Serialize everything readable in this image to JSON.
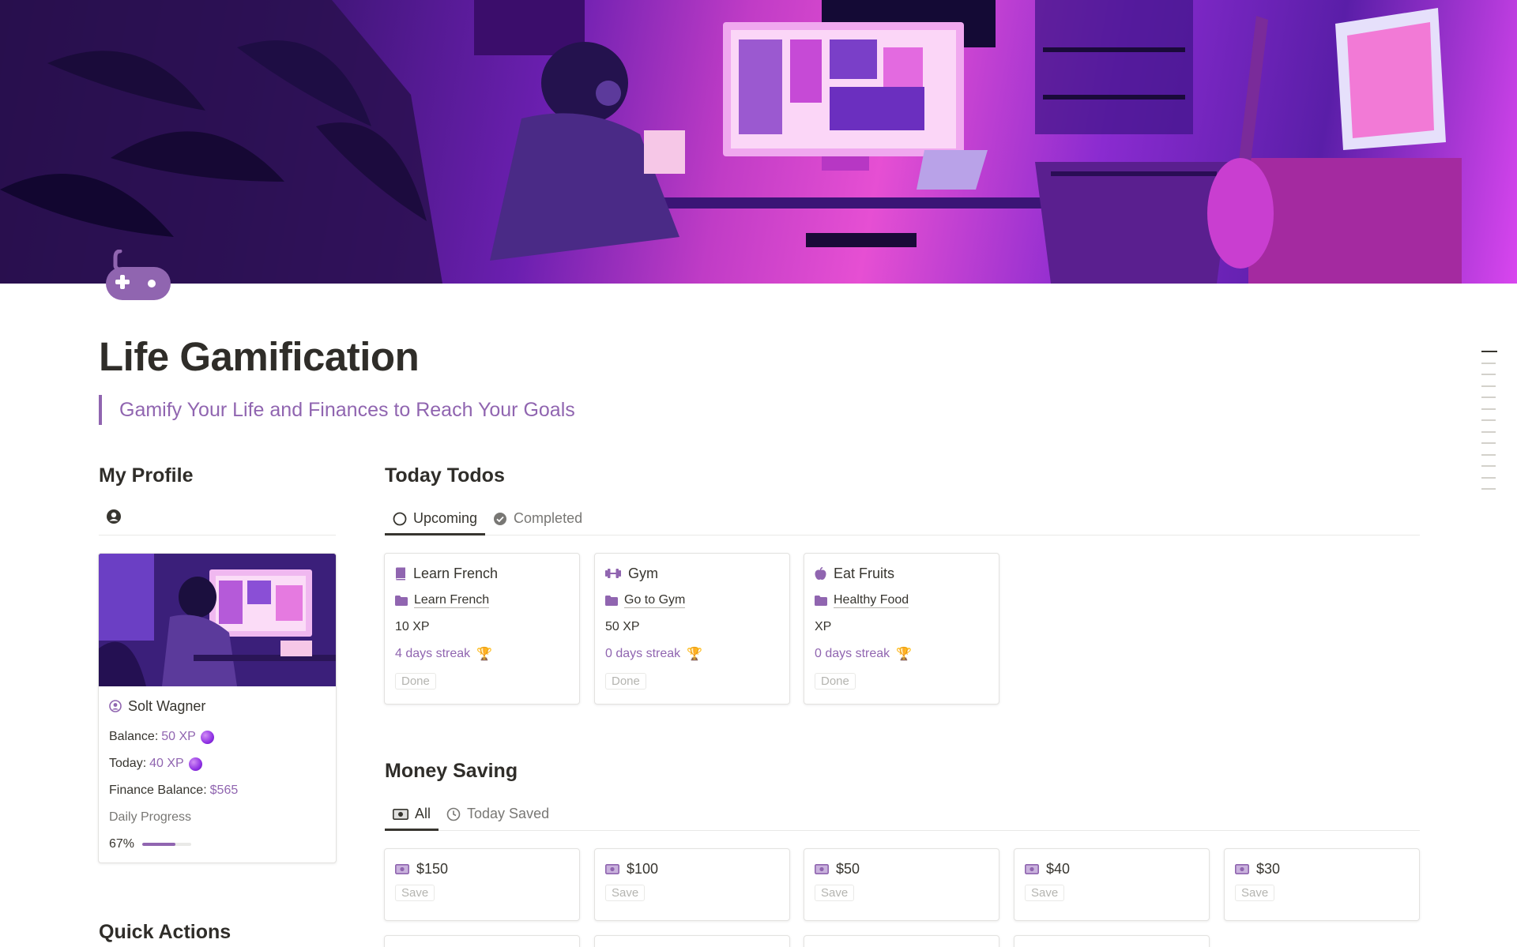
{
  "page": {
    "title": "Life Gamification",
    "quote": "Gamify Your Life and Finances to Reach Your Goals",
    "icon": "gamepad-icon"
  },
  "profile": {
    "heading": "My Profile",
    "icon": "user-circle-icon",
    "name": "Solt Wagner",
    "balance_label": "Balance:",
    "balance_value": "50 XP",
    "today_label": "Today:",
    "today_value": "40 XP",
    "finance_label": "Finance Balance:",
    "finance_value": "$565",
    "daily_progress_label": "Daily Progress",
    "progress_text": "67%",
    "progress": 0.67
  },
  "todos": {
    "heading": "Today Todos",
    "tabs": [
      {
        "label": "Upcoming",
        "icon": "circle-icon",
        "active": true
      },
      {
        "label": "Completed",
        "icon": "check-circle-icon",
        "active": false
      }
    ],
    "cards": [
      {
        "title": "Learn French",
        "icon": "book-icon",
        "category": "Learn French",
        "xp": "10 XP",
        "streak": "4 days streak",
        "button": "Done"
      },
      {
        "title": "Gym",
        "icon": "dumbbell-icon",
        "category": "Go to Gym",
        "xp": "50 XP",
        "streak": "0 days streak",
        "button": "Done"
      },
      {
        "title": "Eat Fruits",
        "icon": "apple-icon",
        "category": "Healthy Food",
        "xp": "XP",
        "streak": "0 days streak",
        "button": "Done"
      }
    ]
  },
  "money": {
    "heading": "Money Saving",
    "tabs": [
      {
        "label": "All",
        "icon": "money-icon",
        "active": true
      },
      {
        "label": "Today Saved",
        "icon": "clock-icon",
        "active": false
      }
    ],
    "cards": [
      {
        "title": "$150",
        "button": "Save"
      },
      {
        "title": "$100",
        "button": "Save"
      },
      {
        "title": "$50",
        "button": "Save"
      },
      {
        "title": "$40",
        "button": "Save"
      },
      {
        "title": "$30",
        "button": "Save"
      }
    ]
  },
  "quick_actions": {
    "heading": "Quick Actions"
  },
  "colors": {
    "accent": "#9065b0",
    "text": "#37352f",
    "muted": "#787774",
    "border": "#e3e2e0"
  }
}
